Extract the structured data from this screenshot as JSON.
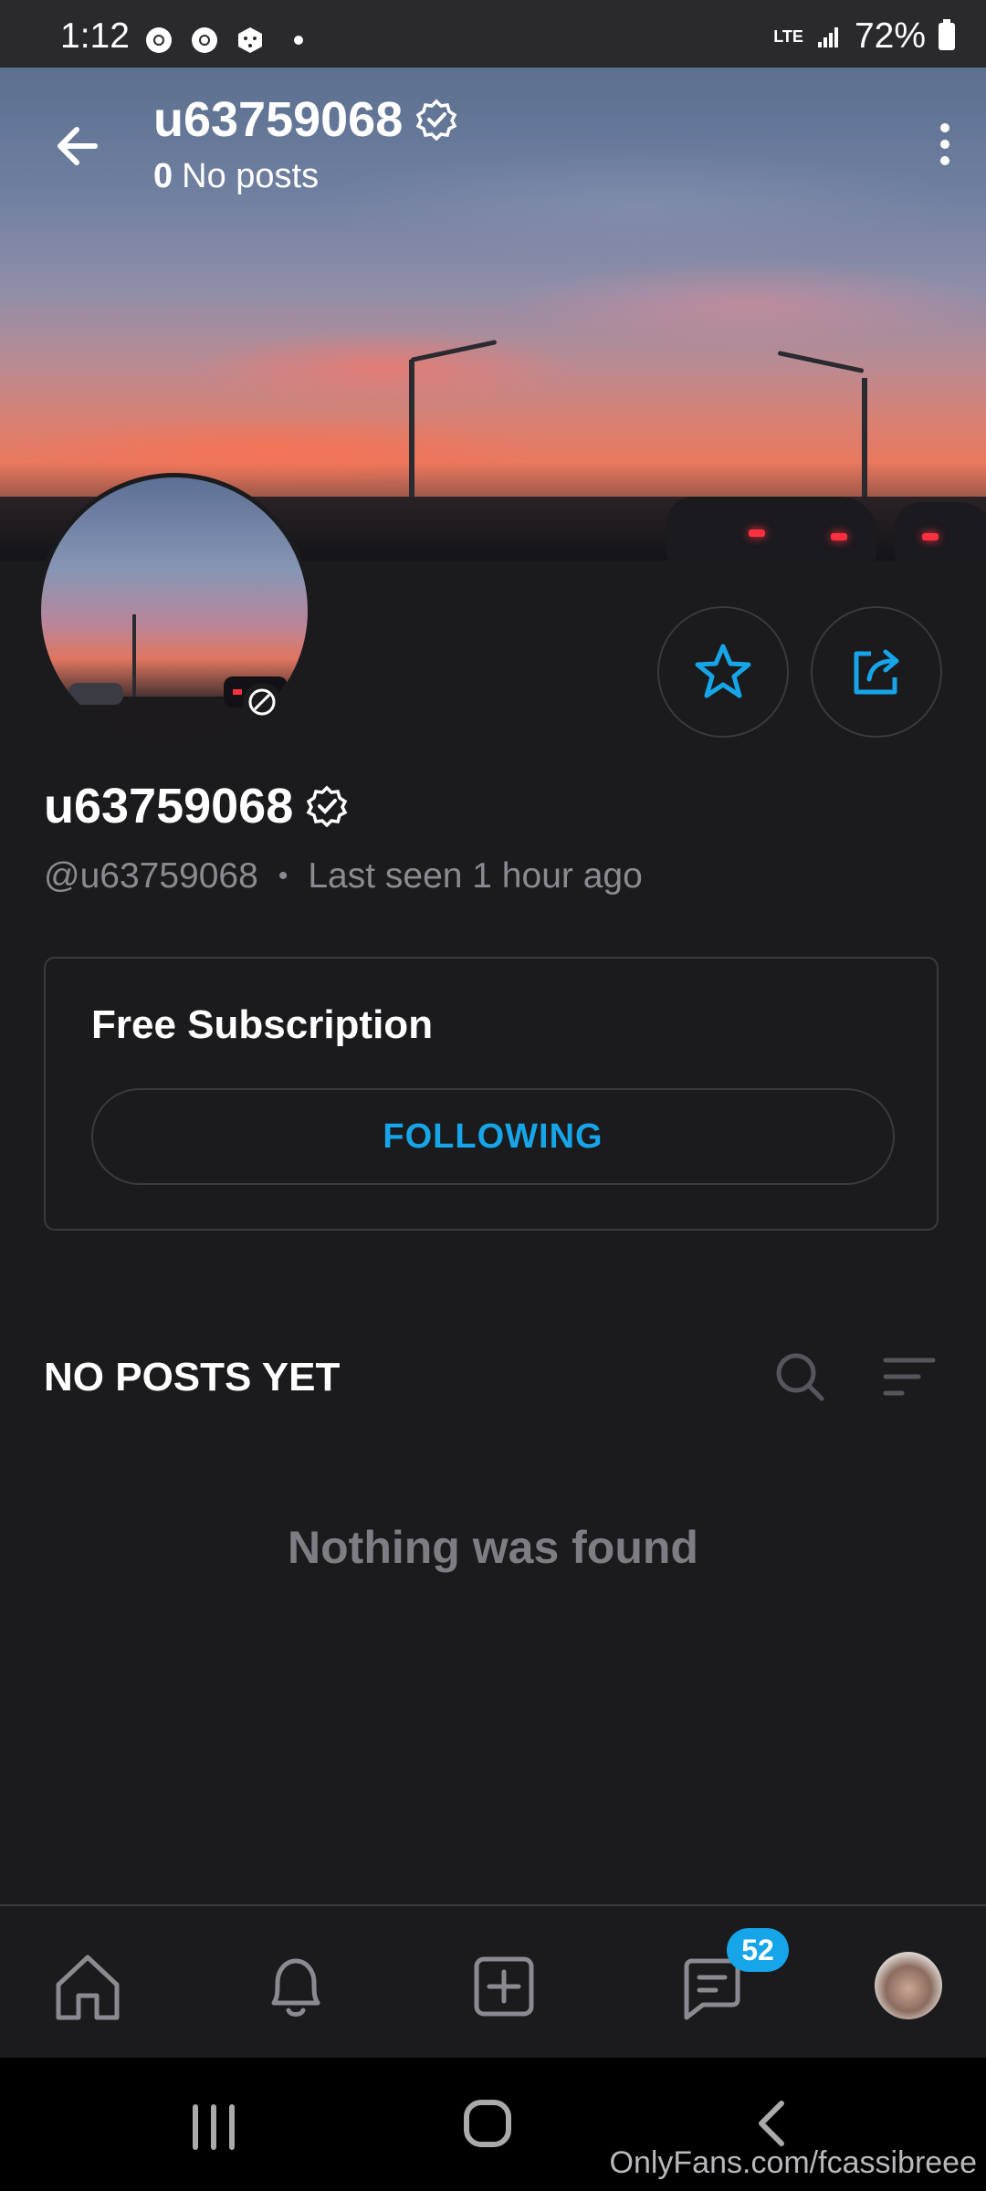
{
  "status_bar": {
    "time": "1:12",
    "network": "LTE",
    "battery": "72%"
  },
  "header": {
    "title": "u63759068",
    "posts_count": "0",
    "posts_label": "No posts"
  },
  "profile": {
    "name": "u63759068",
    "handle": "@u63759068",
    "separator": "•",
    "last_seen": "Last seen 1 hour ago"
  },
  "subscription": {
    "title": "Free Subscription",
    "button_label": "FOLLOWING"
  },
  "posts": {
    "heading": "NO POSTS YET",
    "empty_text": "Nothing was found"
  },
  "bottom_nav": {
    "messages_badge": "52"
  },
  "watermark": "OnlyFans.com/fcassibreee",
  "colors": {
    "accent": "#16a5e8",
    "background": "#1b1b1d",
    "border": "#3a3a3e",
    "muted_text": "#8a8a90"
  },
  "icons": {
    "back": "arrow-left-icon",
    "more": "more-vertical-icon",
    "verified": "verified-badge-icon",
    "star": "star-icon",
    "share": "share-icon",
    "search": "search-icon",
    "sort": "sort-icon",
    "home": "home-icon",
    "bell": "bell-icon",
    "add": "add-post-icon",
    "chat": "chat-icon"
  }
}
